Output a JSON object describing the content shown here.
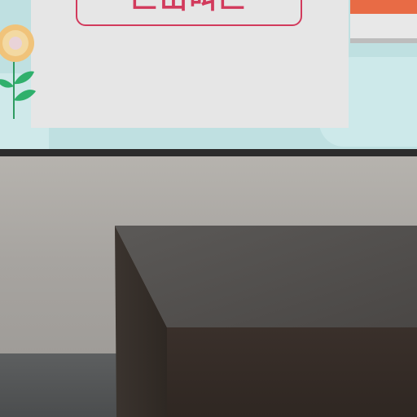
{
  "poster": {
    "label": "匚山叫匚"
  },
  "colors": {
    "wall_teal": "#bfe0e1",
    "poster_bg": "#e6e6e6",
    "label_accent": "#d23a5c",
    "stripe_orange": "#e86b45",
    "frame_line": "#2c2c2c",
    "wall_gray": "#a7a4a0",
    "desk_dark": "#3b342f"
  },
  "icons": {
    "flower": "flower-icon"
  }
}
